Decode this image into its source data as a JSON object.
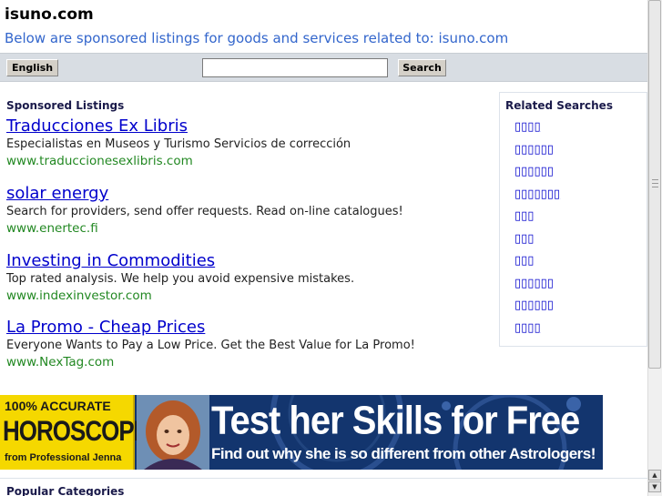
{
  "header": {
    "site_title": "isuno.com",
    "subtitle": "Below are sponsored listings for goods and services related to: isuno.com"
  },
  "toolbar": {
    "language_label": "English",
    "search_value": "",
    "search_label": "Search"
  },
  "sponsored": {
    "heading": "Sponsored Listings",
    "listings": [
      {
        "title": "Traducciones Ex Libris",
        "description": "Especialistas en Museos y Turismo Servicios de corrección",
        "url": "www.traduccionesexlibris.com"
      },
      {
        "title": "solar energy",
        "description": "Search for providers, send offer requests. Read on-line catalogues!",
        "url": "www.enertec.fi"
      },
      {
        "title": "Investing in Commodities",
        "description": "Top rated analysis. We help you avoid expensive mistakes.",
        "url": "www.indexinvestor.com"
      },
      {
        "title": "La Promo - Cheap Prices",
        "description": "Everyone Wants to Pay a Low Price. Get the Best Value for La Promo!",
        "url": "www.NexTag.com"
      }
    ]
  },
  "related": {
    "heading": "Related Searches",
    "items": [
      "▯▯▯▯",
      "▯▯▯▯▯▯",
      "▯▯▯▯▯▯",
      "▯▯▯▯▯▯▯",
      "▯▯▯",
      "▯▯▯",
      "▯▯▯",
      "▯▯▯▯▯▯",
      "▯▯▯▯▯▯",
      "▯▯▯▯"
    ]
  },
  "banner": {
    "accurate_text": "100% ACCURATE",
    "horoscope_text": "HOROSCOPE",
    "from_text": "from Professional Jenna",
    "headline": "Test her Skills for Free",
    "subline": "Find out why she is so different from other Astrologers!"
  },
  "popular": {
    "heading": "Popular Categories"
  },
  "scrollbar": {
    "up_arrow": "▲",
    "down_arrow": "▼"
  },
  "colors": {
    "link": "#0000cc",
    "url_green": "#228822",
    "subtitle_blue": "#3366cc",
    "banner_blue": "#13356e",
    "banner_yellow": "#f5d800"
  }
}
